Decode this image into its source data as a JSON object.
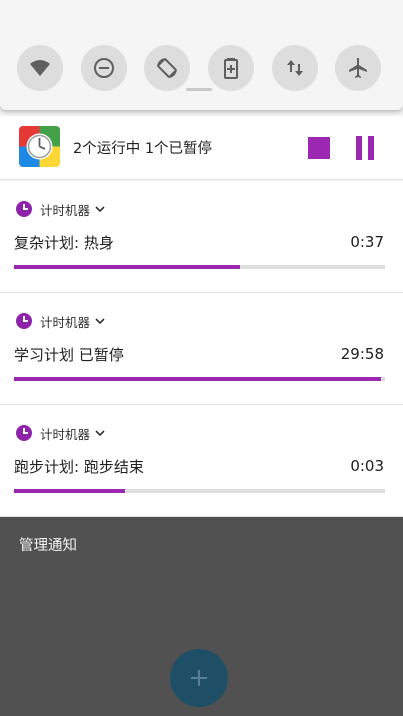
{
  "quick_settings": {
    "tiles": [
      {
        "name": "wifi-icon"
      },
      {
        "name": "do-not-disturb-icon"
      },
      {
        "name": "auto-rotate-icon"
      },
      {
        "name": "battery-saver-icon"
      },
      {
        "name": "mobile-data-icon"
      },
      {
        "name": "airplane-mode-icon"
      }
    ]
  },
  "summary": {
    "text": "2个运行中 1个已暂停",
    "accent": "#9c27b0"
  },
  "notifications": [
    {
      "app": "计时机器",
      "title": "复杂计划: 热身",
      "time": "0:37",
      "progress": 0.61
    },
    {
      "app": "计时机器",
      "title": "学习计划 已暂停",
      "time": "29:58",
      "progress": 0.99
    },
    {
      "app": "计时机器",
      "title": "跑步计划: 跑步结束",
      "time": "0:03",
      "progress": 0.3
    }
  ],
  "footer": {
    "manage_label": "管理通知"
  }
}
